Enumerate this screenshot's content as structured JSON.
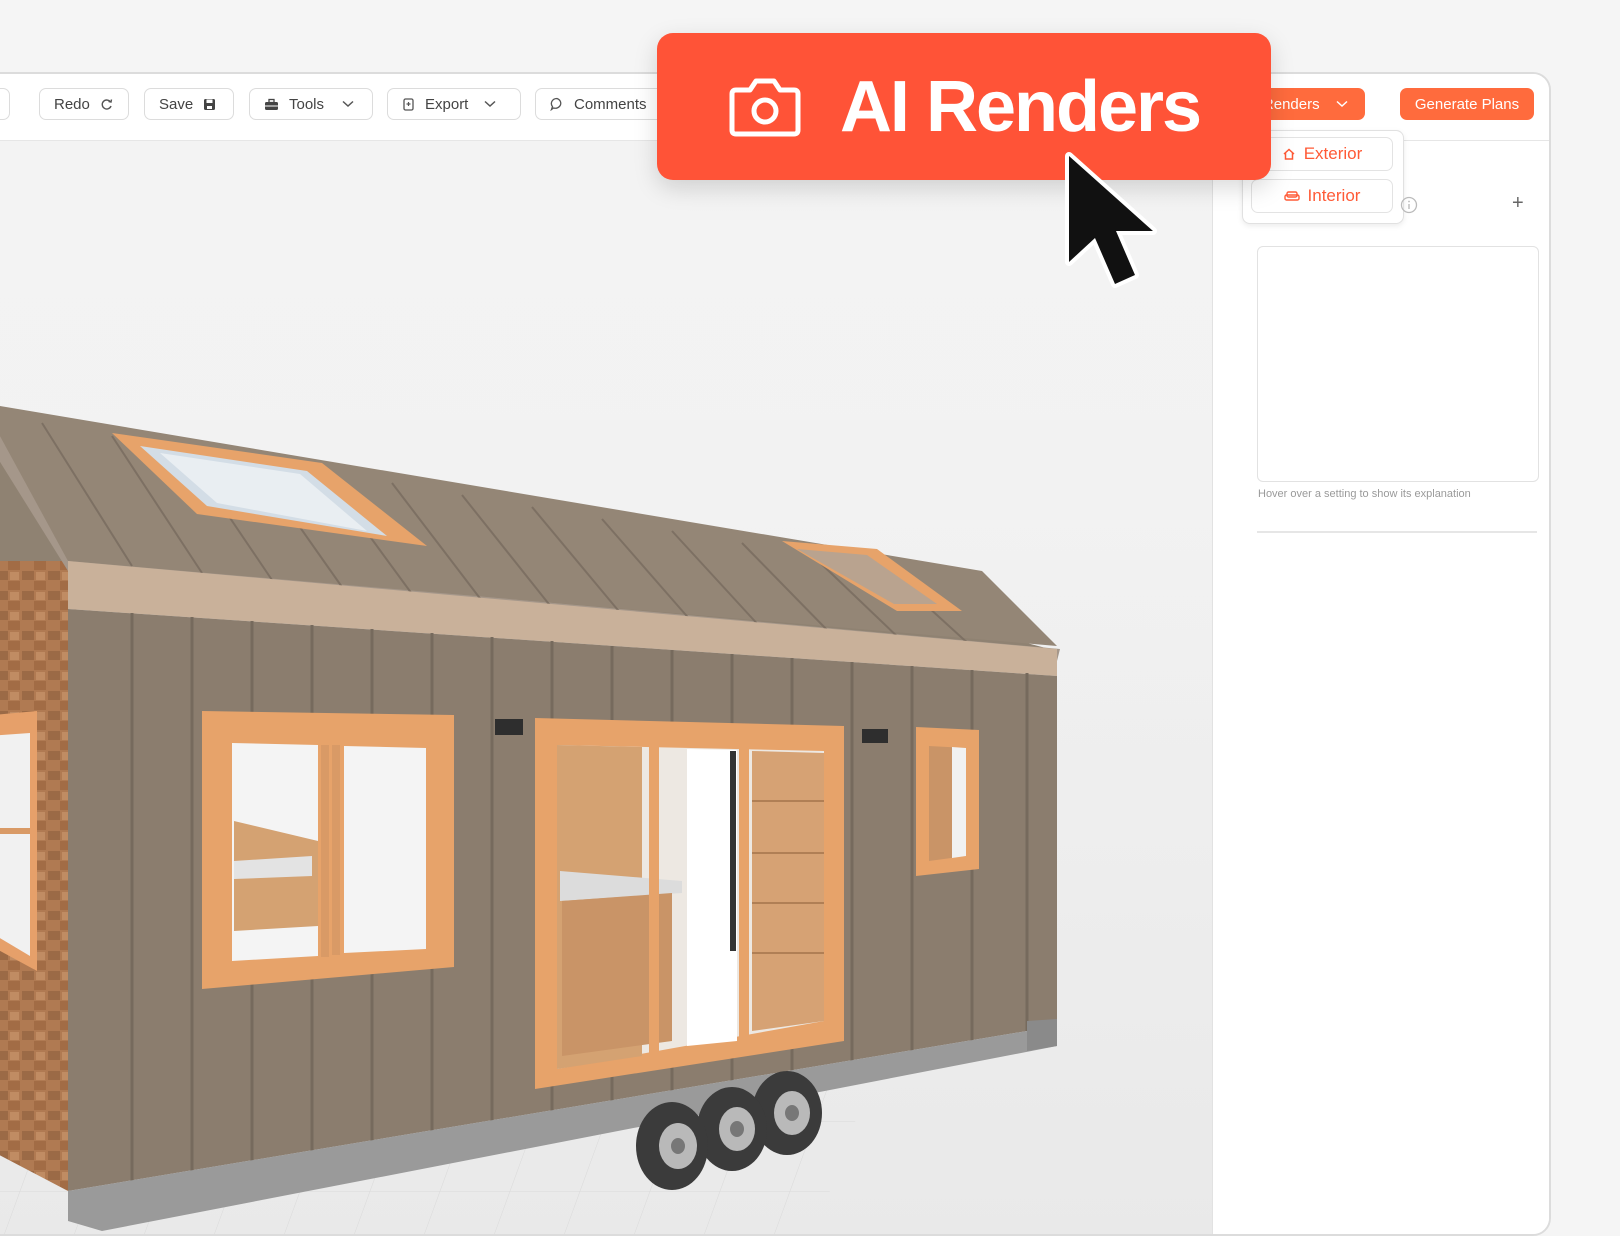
{
  "toolbar": {
    "redo_label": "Redo",
    "save_label": "Save",
    "tools_label": "Tools",
    "export_label": "Export",
    "comments_label": "Comments",
    "ai_renders_label": "l Renders",
    "generate_plans_label": "Generate Plans"
  },
  "dropdown": {
    "items": [
      {
        "label": "Exterior",
        "icon": "house-icon"
      },
      {
        "label": "Interior",
        "icon": "sofa-icon"
      }
    ]
  },
  "panel": {
    "hint": "Hover over a setting to show its explanation"
  },
  "callout": {
    "label": "AI Renders",
    "icon": "camera-icon"
  },
  "colors": {
    "accent": "#ff5337",
    "button_orange": "#ff6b3d",
    "siding": "#8b7d6e",
    "wood_trim": "#e7a36a"
  }
}
